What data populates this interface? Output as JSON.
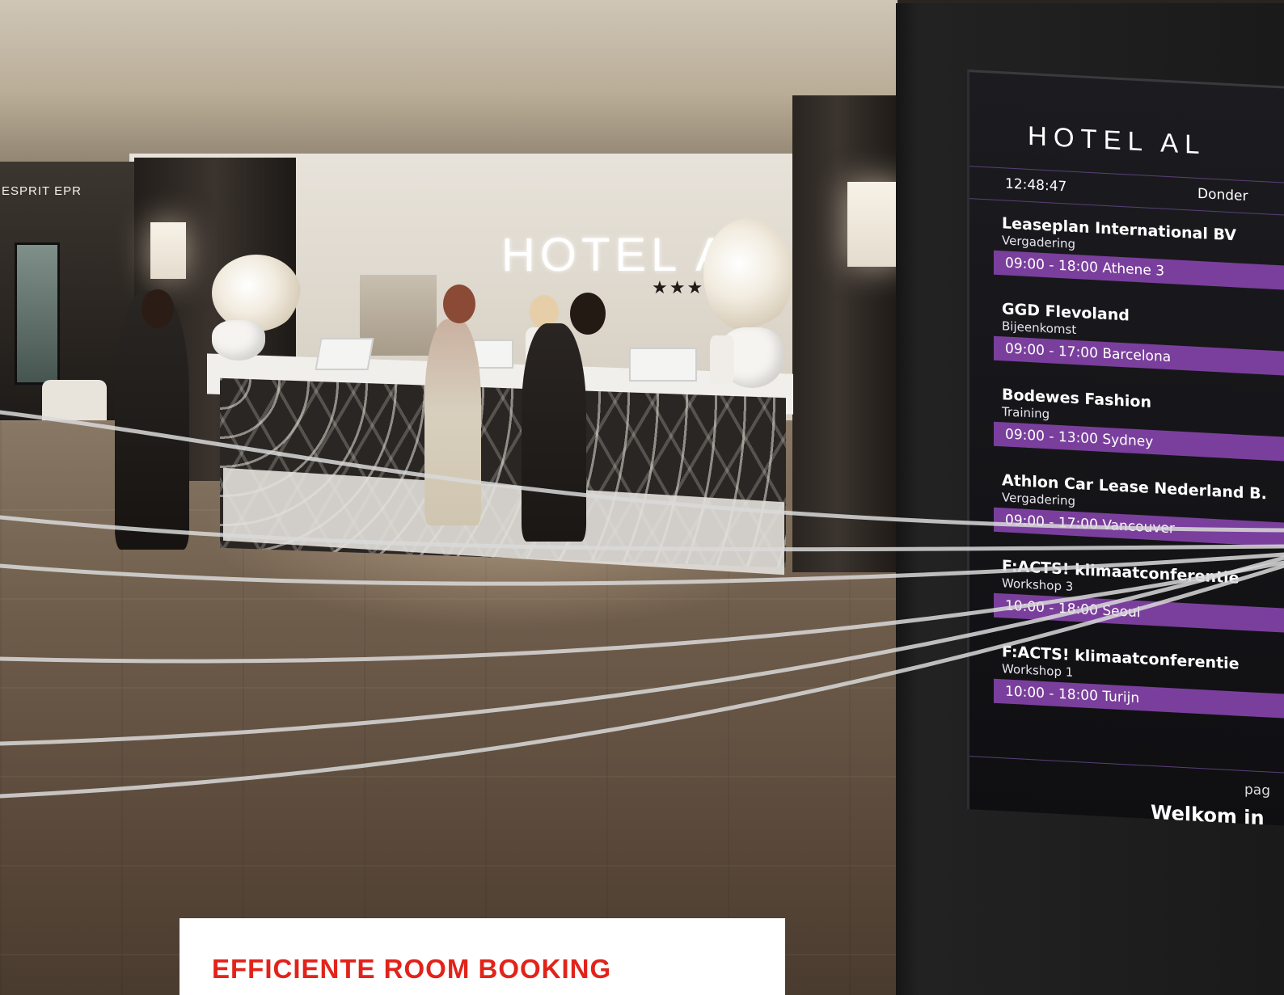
{
  "scene": {
    "left_sign_text": "ESPRIT EPR",
    "wall_logo_text": "HOTEL AL",
    "wall_stars": "★★★"
  },
  "display": {
    "logo": "HOTEL AL",
    "time": "12:48:47",
    "day": "Donder",
    "events": [
      {
        "org": "Leaseplan International BV",
        "type": "Vergadering",
        "slot": "09:00 - 18:00  Athene 3"
      },
      {
        "org": "GGD Flevoland",
        "type": "Bijeenkomst",
        "slot": "09:00 - 17:00  Barcelona"
      },
      {
        "org": "Bodewes Fashion",
        "type": "Training",
        "slot": "09:00 - 13:00  Sydney"
      },
      {
        "org": "Athlon Car Lease Nederland B.",
        "type": "Vergadering",
        "slot": "09:00 - 17:00  Vancouver"
      },
      {
        "org": "F:ACTS! klimaatconferentie",
        "type": "Workshop 3",
        "slot": "10:00 - 18:00  Seoul"
      },
      {
        "org": "F:ACTS! klimaatconferentie",
        "type": "Workshop 1",
        "slot": "10:00 - 18:00  Turijn"
      }
    ],
    "page_label": "pag",
    "welcome": "Welkom in",
    "accent_color": "#7a3f9c"
  },
  "caption": {
    "title": "EFFICIENTE ROOM BOOKING",
    "color": "#e2231a"
  }
}
